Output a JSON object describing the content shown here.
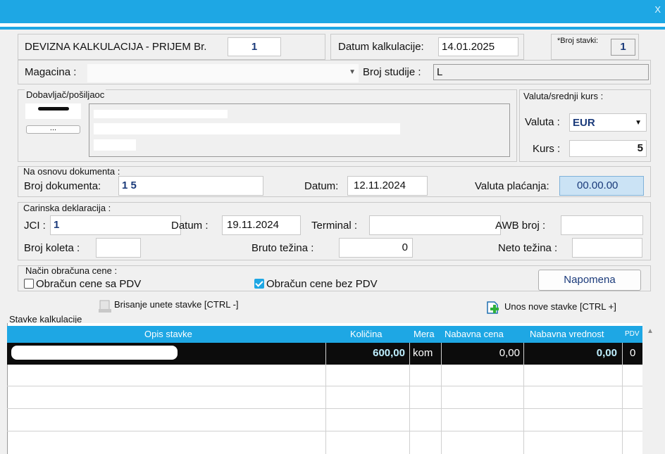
{
  "window": {
    "close_label": "X"
  },
  "header": {
    "title": "DEVIZNA KALKULACIJA - PRIJEM Br.",
    "number": "1",
    "date_label": "Datum kalkulacije:",
    "date_value": "14.01.2025",
    "items_label": "*Broj stavki:",
    "items_value": "1"
  },
  "warehouse": {
    "label": "Magacina :",
    "value": "",
    "study_label": "Broj studije :",
    "study_value": "L"
  },
  "supplier": {
    "group_label": "Dobavljač/pošiljaoc",
    "browse_label": "...",
    "currency_group_label": "Valuta/srednji kurs :",
    "currency_label": "Valuta :",
    "currency_value": "EUR",
    "rate_label": "Kurs :",
    "rate_value": "5"
  },
  "document": {
    "group_label": "Na osnovu dokumenta :",
    "number_label": "Broj dokumenta:",
    "number_value": "1 5",
    "date_label": "Datum:",
    "date_value": "12.11.2024",
    "payment_label": "Valuta plaćanja:",
    "payment_value": "00.00.00"
  },
  "customs": {
    "group_label": "Carinska deklaracija :",
    "jci_label": "JCI :",
    "jci_value": "1",
    "date_label": "Datum :",
    "date_value": "19.11.2024",
    "terminal_label": "Terminal :",
    "terminal_value": "",
    "awb_label": "AWB broj :",
    "awb_value": "",
    "packages_label": "Broj koleta :",
    "packages_value": "",
    "gross_label": "Bruto težina :",
    "gross_value": "0",
    "net_label": "Neto težina :",
    "net_value": ""
  },
  "pricing": {
    "group_label": "Način obračuna cene :",
    "with_vat_label": "Obračun cene sa PDV",
    "with_vat_checked": false,
    "without_vat_label": "Obračun cene bez PDV",
    "without_vat_checked": true,
    "note_button": "Napomena"
  },
  "items_toolbar": {
    "delete_label": "Brisanje unete stavke [CTRL -]",
    "add_label": "Unos nove stavke [CTRL +]",
    "section_label": "Stavke kalkulacije"
  },
  "table": {
    "columns": [
      "Opis stavke",
      "Količina",
      "Mera",
      "Nabavna cena",
      "Nabavna vrednost",
      "PDV"
    ],
    "rows": [
      {
        "description": "",
        "quantity": "600,00",
        "unit": "kom",
        "price": "0,00",
        "value": "0,00",
        "vat": "0"
      }
    ]
  },
  "colors": {
    "accent": "#1ea7e4",
    "background": "#f0f0f0",
    "selected_row": "#0c0c0c",
    "qty_text": "#bfefff"
  },
  "icons": [
    "delete-row-icon",
    "add-row-icon",
    "dropdown-arrow-icon",
    "scroll-up-icon"
  ]
}
